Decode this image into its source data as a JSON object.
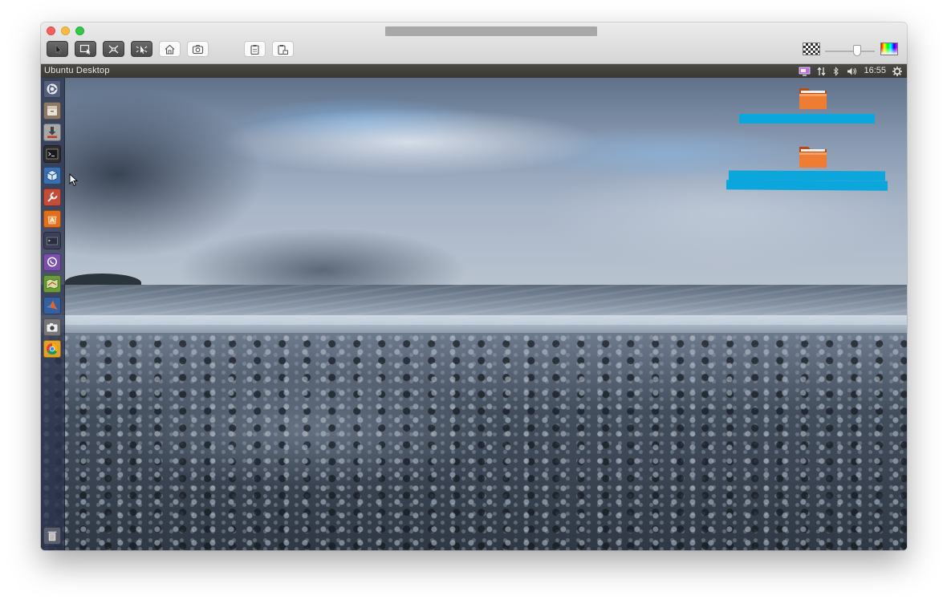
{
  "host": {
    "window_title": "",
    "toolbar_buttons": [
      {
        "name": "select-pointer",
        "icon": "pointer-icon",
        "style": "dark"
      },
      {
        "name": "select-window",
        "icon": "window-select-icon",
        "style": "dark"
      },
      {
        "name": "fit-window",
        "icon": "fit-icon",
        "style": "dark"
      },
      {
        "name": "pointer-capture",
        "icon": "capture-pointer-icon",
        "style": "dark"
      },
      {
        "name": "home-screen",
        "icon": "home-icon",
        "style": "light"
      },
      {
        "name": "screenshot",
        "icon": "camera-icon",
        "style": "light"
      },
      {
        "name": "copy",
        "icon": "clipboard-copy-icon",
        "style": "light"
      },
      {
        "name": "paste",
        "icon": "clipboard-paste-icon",
        "style": "light"
      }
    ],
    "quality_slider_value": 0.65
  },
  "guest": {
    "panel_title": "Ubuntu Desktop",
    "clock": "16:55",
    "tray_icons": [
      "display-icon",
      "network-icon",
      "bluetooth-icon",
      "volume-icon",
      "settings-gear-icon"
    ],
    "launcher_items": [
      {
        "name": "dash-home",
        "icon": "ubuntu-logo-icon",
        "color": "#5e6b8a"
      },
      {
        "name": "files",
        "icon": "file-cabinet-icon",
        "color": "#8c7a66"
      },
      {
        "name": "installer",
        "icon": "install-icon",
        "color": "#a8a8a8"
      },
      {
        "name": "terminal",
        "icon": "terminal-icon",
        "color": "#2e2e2e"
      },
      {
        "name": "virtualbox",
        "icon": "virtualbox-icon",
        "color": "#3a6fb0"
      },
      {
        "name": "system-tools",
        "icon": "wrench-icon",
        "color": "#c44d3a"
      },
      {
        "name": "software-center",
        "icon": "software-center-icon",
        "color": "#e07020"
      },
      {
        "name": "console",
        "icon": "console-icon",
        "color": "#3c3f58"
      },
      {
        "name": "viber",
        "icon": "viber-icon",
        "color": "#7a4fb0"
      },
      {
        "name": "maps",
        "icon": "map-icon",
        "color": "#6b9a3a"
      },
      {
        "name": "matlab",
        "icon": "matlab-icon",
        "color": "#d2562a"
      },
      {
        "name": "camera",
        "icon": "camera-icon",
        "color": "#777777"
      },
      {
        "name": "chrome",
        "icon": "chrome-icon",
        "color": "#e0a22c"
      }
    ],
    "trash": {
      "name": "trash",
      "icon": "trash-icon"
    },
    "desktop_folders": [
      {
        "name": "folder-1",
        "icon": "folder-icon",
        "label": ""
      },
      {
        "name": "folder-2",
        "icon": "folder-icon",
        "label": ""
      }
    ]
  }
}
